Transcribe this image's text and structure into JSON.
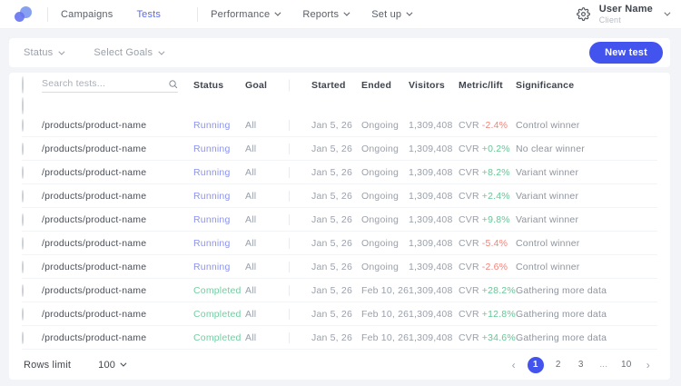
{
  "nav": {
    "items": [
      {
        "label": "Campaigns"
      },
      {
        "label": "Tests"
      },
      {
        "label": "Performance"
      },
      {
        "label": "Reports"
      },
      {
        "label": "Set up"
      }
    ],
    "user": {
      "name": "User Name",
      "role": "Client"
    }
  },
  "filters": {
    "status_label": "Status",
    "goals_label": "Select Goals",
    "new_test_label": "New test"
  },
  "table": {
    "search_placeholder": "Search tests...",
    "columns": [
      "Status",
      "Goal",
      "Started",
      "Ended",
      "Visitors",
      "Metric/lift",
      "Significance"
    ],
    "rows": [
      {
        "name": "/products/product-name",
        "status": "Running",
        "goal": "All",
        "started": "Jan 5, 26",
        "ended": "Ongoing",
        "visitors": "1,309,408",
        "metric": "CVR",
        "lift": "-2.4%",
        "significance": "Control winner"
      },
      {
        "name": "/products/product-name",
        "status": "Running",
        "goal": "All",
        "started": "Jan 5, 26",
        "ended": "Ongoing",
        "visitors": "1,309,408",
        "metric": "CVR",
        "lift": "+0.2%",
        "significance": "No clear winner"
      },
      {
        "name": "/products/product-name",
        "status": "Running",
        "goal": "All",
        "started": "Jan 5, 26",
        "ended": "Ongoing",
        "visitors": "1,309,408",
        "metric": "CVR",
        "lift": "+8.2%",
        "significance": "Variant winner"
      },
      {
        "name": "/products/product-name",
        "status": "Running",
        "goal": "All",
        "started": "Jan 5, 26",
        "ended": "Ongoing",
        "visitors": "1,309,408",
        "metric": "CVR",
        "lift": "+2.4%",
        "significance": "Variant winner"
      },
      {
        "name": "/products/product-name",
        "status": "Running",
        "goal": "All",
        "started": "Jan 5, 26",
        "ended": "Ongoing",
        "visitors": "1,309,408",
        "metric": "CVR",
        "lift": "+9.8%",
        "significance": "Variant winner"
      },
      {
        "name": "/products/product-name",
        "status": "Running",
        "goal": "All",
        "started": "Jan 5, 26",
        "ended": "Ongoing",
        "visitors": "1,309,408",
        "metric": "CVR",
        "lift": "-5.4%",
        "significance": "Control winner"
      },
      {
        "name": "/products/product-name",
        "status": "Running",
        "goal": "All",
        "started": "Jan 5, 26",
        "ended": "Ongoing",
        "visitors": "1,309,408",
        "metric": "CVR",
        "lift": "-2.6%",
        "significance": "Control winner"
      },
      {
        "name": "/products/product-name",
        "status": "Completed",
        "goal": "All",
        "started": "Jan 5, 26",
        "ended": "Feb 10, 26",
        "visitors": "1,309,408",
        "metric": "CVR",
        "lift": "+28.2%",
        "significance": "Gathering more data"
      },
      {
        "name": "/products/product-name",
        "status": "Completed",
        "goal": "All",
        "started": "Jan 5, 26",
        "ended": "Feb 10, 26",
        "visitors": "1,309,408",
        "metric": "CVR",
        "lift": "+12.8%",
        "significance": "Gathering more data"
      },
      {
        "name": "/products/product-name",
        "status": "Completed",
        "goal": "All",
        "started": "Jan 5, 26",
        "ended": "Feb 10, 26",
        "visitors": "1,309,408",
        "metric": "CVR",
        "lift": "+34.6%",
        "significance": "Gathering more data"
      }
    ]
  },
  "footer": {
    "rows_limit_label": "Rows limit",
    "rows_limit_value": "100",
    "pagination": {
      "prev": "‹",
      "next": "›",
      "pages": [
        "1",
        "2",
        "3",
        "...",
        "10"
      ],
      "active": "1"
    }
  },
  "colors": {
    "accent": "#4353ee",
    "running": "#8b93f1",
    "completed": "#74cda2",
    "lift_positive": "#66c795",
    "lift_negative": "#f2837b"
  }
}
